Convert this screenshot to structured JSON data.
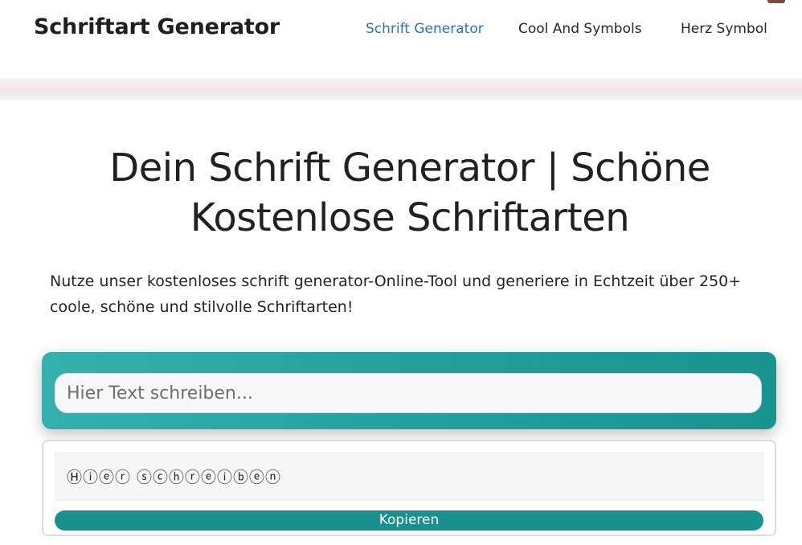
{
  "header": {
    "brand": "Schriftart Generator",
    "nav": [
      {
        "label": "Schrift Generator",
        "active": true
      },
      {
        "label": "Cool And Symbols",
        "active": false
      },
      {
        "label": "Herz Symbol",
        "active": false
      }
    ]
  },
  "hero": {
    "title_line1": "Dein Schrift Generator | Schöne",
    "title_line2": "Kostenlose Schriftarten",
    "intro_line1": "Nutze unser kostenloses schrift generator-Online-Tool und generiere in Echtzeit über 250+",
    "intro_line2": "coole, schöne und stilvolle Schriftarten!"
  },
  "generator": {
    "input_placeholder": "Hier Text schreiben...",
    "input_value": "",
    "result_text": "Ⓗⓘⓔⓡ ⓢⓒⓗⓡⓔⓘⓑⓔⓝ",
    "copy_label": "Kopieren"
  },
  "colors": {
    "accent_nav": "#2b73b6",
    "teal": "#1a908e"
  }
}
